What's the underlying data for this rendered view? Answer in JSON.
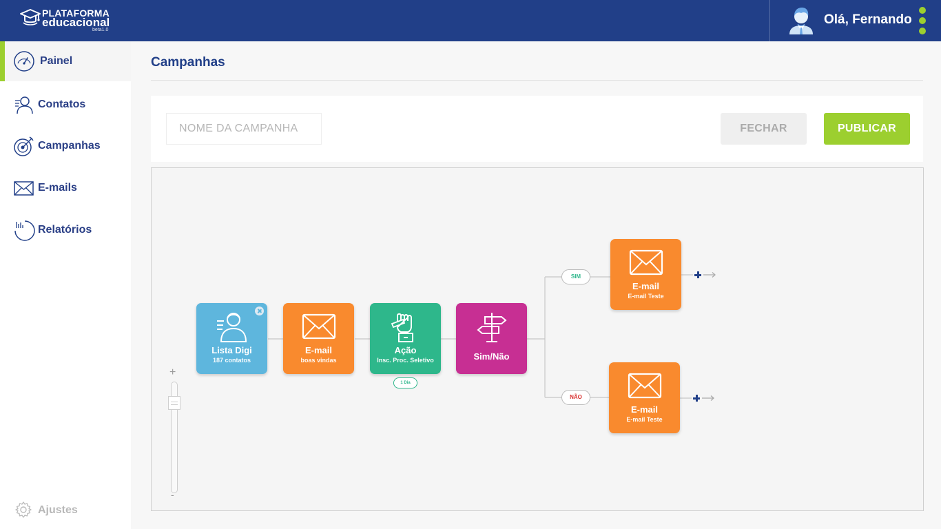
{
  "header": {
    "logo_line1": "PLATAFORMA",
    "logo_line2": "educacional",
    "logo_version": "beta1.0",
    "greeting": "Olá, Fernando",
    "user_icon": "user-avatar-icon",
    "menu_icon": "kebab-menu-icon"
  },
  "sidebar": {
    "items": [
      {
        "label": "Painel",
        "icon": "speedometer-icon",
        "active": true
      },
      {
        "label": "Contatos",
        "icon": "contacts-icon"
      },
      {
        "label": "Campanhas",
        "icon": "target-icon"
      },
      {
        "label": "E-mails",
        "icon": "envelope-icon"
      },
      {
        "label": "Relatórios",
        "icon": "chart-icon"
      }
    ],
    "settings_label": "Ajustes"
  },
  "main": {
    "title": "Campanhas",
    "campaign_name_placeholder": "NOME DA CAMPANHA",
    "campaign_name_value": "",
    "close_label": "FECHAR",
    "publish_label": "PUBLICAR"
  },
  "flow": {
    "nodes": [
      {
        "title": "Lista Digi",
        "subtitle": "187 contatos",
        "color": "#5eb6dd",
        "icon": "person-list-icon"
      },
      {
        "title": "E-mail",
        "subtitle": "boas vindas",
        "color": "#f98a2e",
        "icon": "envelope-icon"
      },
      {
        "title": "Ação",
        "subtitle": "Insc. Proc. Seletivo",
        "color": "#2eb78b",
        "icon": "raised-fist-icon"
      },
      {
        "title": "Sim/Não",
        "color": "#c72f93",
        "icon": "signpost-icon"
      },
      {
        "title": "E-mail",
        "subtitle": "E-mail Teste",
        "color": "#f98a2e",
        "icon": "envelope-icon"
      },
      {
        "title": "E-mail",
        "subtitle": "E-mail Teste",
        "color": "#f98a2e",
        "icon": "envelope-icon"
      }
    ],
    "delay_label": "1 Dia",
    "yes_label": "SIM",
    "no_label": "NÃO"
  },
  "zoom": {
    "plus": "+",
    "minus": "-"
  },
  "colors": {
    "brand_blue": "#213f88",
    "accent_green": "#9ccf2f"
  }
}
